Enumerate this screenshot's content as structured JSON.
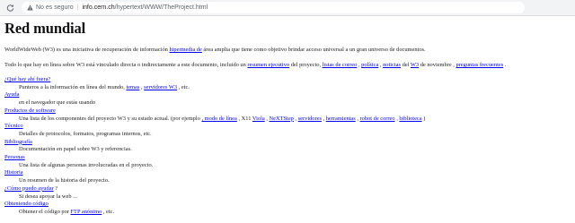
{
  "browser": {
    "security_label": "No es seguro",
    "url_host": "info.cern.ch",
    "url_path": "/hypertext/WWW/TheProject.html"
  },
  "page": {
    "title": "Red mundial",
    "intro": {
      "t1": "WorldWideWeb (W3) es una iniciativa de recuperación de información ",
      "link": "hipermedia de",
      "t2": " área amplia que tiene como objetivo brindar acceso universal a un gran universo de documentos."
    },
    "summary": {
      "t1": "Todo lo que hay en línea sobre W3 está vinculado directa o indirectamente a este documento, incluido un ",
      "l1": "resumen ejecutivo",
      "t2": " del proyecto, ",
      "l2": "listas de correo",
      "t3": " , ",
      "l3": "política",
      "t4": " , ",
      "l4": "noticias",
      "t5": " del ",
      "l5": "W3",
      "t6": " de noviembre , ",
      "l6": "preguntas frecuentes",
      "t7": " ."
    },
    "sections": {
      "que_hay": {
        "title": "¿Qué hay ahí fuera?",
        "t1": "Punteros a la información en línea del mundo, ",
        "l1": "temas",
        "t2": " , ",
        "l2": "servidores W3",
        "t3": " , etc."
      },
      "ayuda": {
        "title": "Ayuda",
        "desc": "en el navegador que estás usando"
      },
      "productos": {
        "title": "Productos de software",
        "t1": "Una lista de los componentes del proyecto W3 y su estado actual. (por ejemplo ",
        "l1": ", modo de línea",
        "t2": " , X11 ",
        "l2": "Viola",
        "t3": " , ",
        "l3": "NeXTStep",
        "t4": " , ",
        "l4": "servidores",
        "t5": " , ",
        "l5": "herramientas",
        "t6": " , ",
        "l6": "robot de correo",
        "t7": " , ",
        "l7": "biblioteca",
        "t8": " )"
      },
      "tecnico": {
        "title": "Técnico",
        "desc": "Detalles de protocolos, formatos, programas internos, etc."
      },
      "bibliografia": {
        "title": "Bibliografía",
        "desc": "Documentación en papel sobre W3 y referencias."
      },
      "personas": {
        "title": "Personas",
        "desc": "Una lista de algunas personas involucradas en el proyecto."
      },
      "historia": {
        "title": "Historia",
        "desc": "Un resumen de la historia del proyecto."
      },
      "ayudar": {
        "title": "¿Cómo puedo ayudar",
        "suffix": " ?",
        "desc": "Si desea apoyar la web ..."
      },
      "obteniendo": {
        "title": "Obteniendo código",
        "t1": "Obtener el código por ",
        "l1": "FTP anónimo",
        "t2": " , etc."
      }
    }
  }
}
